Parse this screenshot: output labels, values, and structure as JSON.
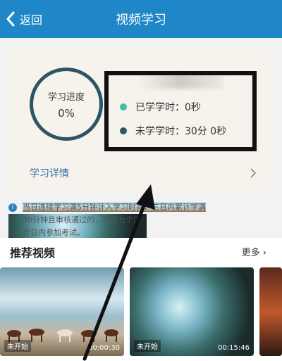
{
  "navbar": {
    "back_label": "返回",
    "title": "视频学习"
  },
  "progress": {
    "ring_label": "学习进度",
    "percent": "0%"
  },
  "stats": {
    "learned": "已学学时：0秒",
    "remaining": "未学学时：30分 0秒",
    "learned_dot_color": "#3fbfa6",
    "remaining_dot_color": "#2d5566"
  },
  "detail": {
    "label": "学习详情"
  },
  "notice": {
    "line1": "当日连续学习满5分钟计入学习时间，三日内累计学满",
    "line2": "30分钟且审核通过的，可在七个工作日内参加考试。"
  },
  "recommend": {
    "title": "推荐视频",
    "more_label": "更多",
    "videos": [
      {
        "status": "未开始",
        "duration": "00:00:30"
      },
      {
        "status": "未开始",
        "duration": "00:15:46"
      },
      {
        "status": "",
        "duration": ""
      }
    ]
  }
}
